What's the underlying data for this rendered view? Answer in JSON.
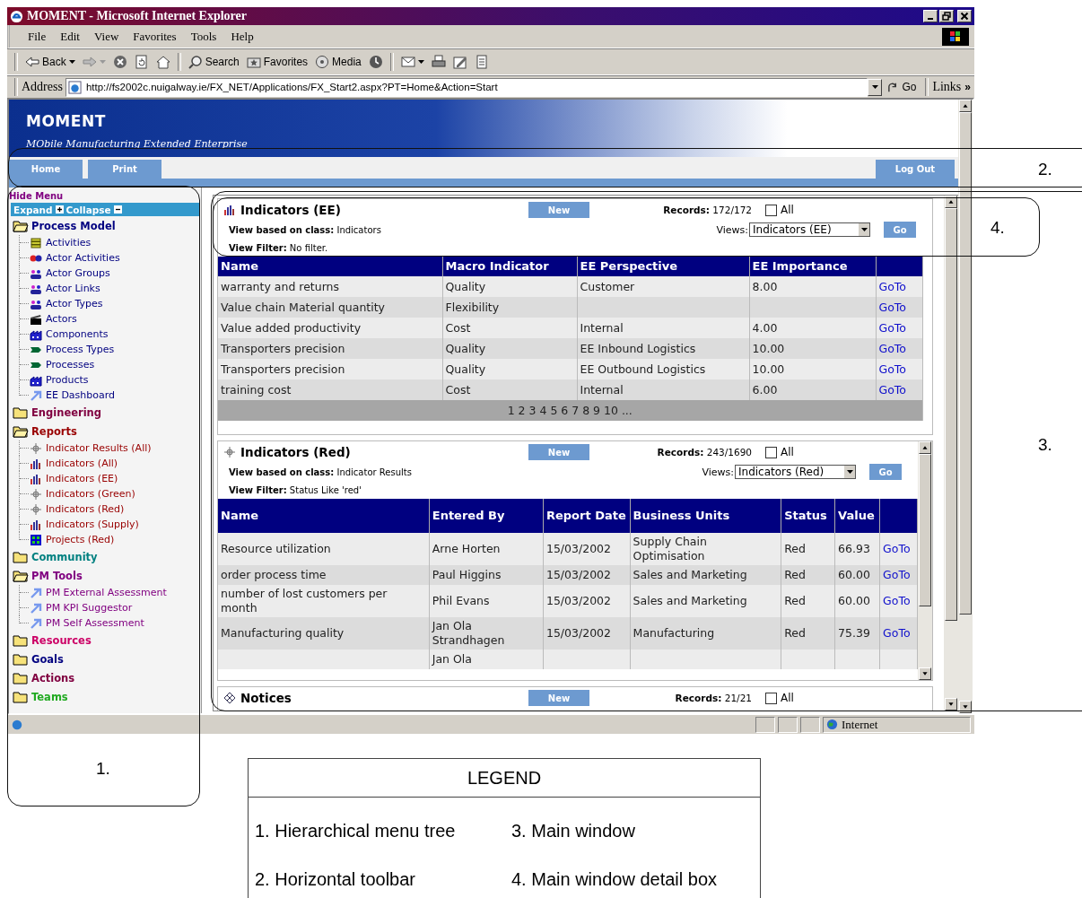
{
  "window": {
    "title": "MOMENT - Microsoft Internet Explorer"
  },
  "menu_bar": [
    "File",
    "Edit",
    "View",
    "Favorites",
    "Tools",
    "Help"
  ],
  "toolbar_groups": [
    [
      {
        "kind": "back",
        "label": "Back"
      },
      {
        "kind": "forward"
      },
      {
        "kind": "stop"
      },
      {
        "kind": "refresh"
      },
      {
        "kind": "home"
      }
    ],
    [
      {
        "kind": "search",
        "label": "Search"
      },
      {
        "kind": "favorites",
        "label": "Favorites"
      },
      {
        "kind": "media",
        "label": "Media"
      },
      {
        "kind": "history"
      }
    ],
    [
      {
        "kind": "mail"
      },
      {
        "kind": "print"
      },
      {
        "kind": "edit"
      },
      {
        "kind": "discuss"
      }
    ]
  ],
  "address_bar": {
    "label": "Address",
    "url": "http://fs2002c.nuigalway.ie/FX_NET/Applications/FX_Start2.aspx?PT=Home&Action=Start",
    "go": "Go",
    "links": "Links",
    "links_more": "»"
  },
  "site": {
    "title": "MOMENT",
    "subtitle": "MObile Manufacturing Extended Enterprise"
  },
  "nav_tabs": [
    {
      "label": "Home"
    },
    {
      "label": "Print"
    }
  ],
  "logout": "Log Out",
  "sidebar": {
    "hide_menu": "Hide Menu",
    "expand": "Expand",
    "collapse": "Collapse",
    "groups": [
      {
        "label": "Process Model",
        "color": "#000080",
        "expanded": true,
        "children": [
          {
            "label": "Activities",
            "kind": "coins"
          },
          {
            "label": "Actor Activities",
            "kind": "actor"
          },
          {
            "label": "Actor Groups",
            "kind": "people"
          },
          {
            "label": "Actor Links",
            "kind": "people"
          },
          {
            "label": "Actor Types",
            "kind": "people"
          },
          {
            "label": "Actors",
            "kind": "clapper"
          },
          {
            "label": "Components",
            "kind": "building"
          },
          {
            "label": "Process Types",
            "kind": "process"
          },
          {
            "label": "Processes",
            "kind": "process"
          },
          {
            "label": "Products",
            "kind": "building"
          },
          {
            "label": "EE Dashboard",
            "kind": "arrow"
          }
        ]
      },
      {
        "label": "Engineering",
        "color": "#800040",
        "expanded": false
      },
      {
        "label": "Reports",
        "color": "#990000",
        "expanded": true,
        "children": [
          {
            "label": "Indicator Results (All)",
            "kind": "target"
          },
          {
            "label": "Indicators (All)",
            "kind": "chart"
          },
          {
            "label": "Indicators (EE)",
            "kind": "chart"
          },
          {
            "label": "Indicators (Green)",
            "kind": "target"
          },
          {
            "label": "Indicators (Red)",
            "kind": "target"
          },
          {
            "label": "Indicators (Supply)",
            "kind": "chart"
          },
          {
            "label": "Projects (Red)",
            "kind": "grid"
          }
        ]
      },
      {
        "label": "Community",
        "color": "#008080",
        "expanded": false
      },
      {
        "label": "PM Tools",
        "color": "#800080",
        "expanded": true,
        "children": [
          {
            "label": "PM External Assessment",
            "kind": "arrow"
          },
          {
            "label": "PM KPI Suggestor",
            "kind": "arrow"
          },
          {
            "label": "PM Self Assessment",
            "kind": "arrow"
          }
        ]
      },
      {
        "label": "Resources",
        "color": "#cc0066",
        "expanded": false
      },
      {
        "label": "Goals",
        "color": "#000080",
        "expanded": false
      },
      {
        "label": "Actions",
        "color": "#800040",
        "expanded": false
      },
      {
        "label": "Teams",
        "color": "#22aa22",
        "expanded": false
      }
    ]
  },
  "panels": [
    {
      "title": "Indicators (EE)",
      "kind": "chart",
      "new_label": "New",
      "records_label": "Records:",
      "records": "172/172",
      "all_label": "All",
      "all_checked": false,
      "class_label": "View based on class:",
      "class_value": "Indicators",
      "views_label": "Views:",
      "views_value": "Indicators (EE)",
      "go": "Go",
      "filter_label": "View Filter:",
      "filter_value": "No filter.",
      "columns": [
        "Name",
        "Macro Indicator",
        "EE Perspective",
        "EE Importance",
        null
      ],
      "rows": [
        [
          "warranty and returns",
          "Quality",
          "Customer",
          "8.00",
          "GoTo"
        ],
        [
          "Value chain Material quantity",
          "Flexibility",
          null,
          null,
          "GoTo"
        ],
        [
          "Value added productivity",
          "Cost",
          "Internal",
          "4.00",
          "GoTo"
        ],
        [
          "Transporters precision",
          "Quality",
          "EE Inbound Logistics",
          "10.00",
          "GoTo"
        ],
        [
          "Transporters precision",
          "Quality",
          "EE Outbound Logistics",
          "10.00",
          "GoTo"
        ],
        [
          "training cost",
          "Cost",
          "Internal",
          "6.00",
          "GoTo"
        ]
      ],
      "pager": "1 2 3 4 5 6 7 8 9 10 ..."
    },
    {
      "title": "Indicators (Red)",
      "kind": "target",
      "new_label": "New",
      "records_label": "Records:",
      "records": "243/1690",
      "all_label": "All",
      "all_checked": false,
      "class_label": "View based on class:",
      "class_value": "Indicator Results",
      "views_label": "Views:",
      "views_value": "Indicators (Red)",
      "go": "Go",
      "filter_label": "View Filter:",
      "filter_value": "Status Like 'red'",
      "columns": [
        "Name",
        "Entered By",
        "Report Date",
        "Business Units",
        "Status",
        "Value",
        null
      ],
      "rows": [
        [
          "Resource utilization",
          "Arne Horten",
          "15/03/2002",
          "Supply Chain Optimisation",
          "Red",
          "66.93",
          "GoTo"
        ],
        [
          "order process time",
          "Paul Higgins",
          "15/03/2002",
          "Sales and Marketing",
          "Red",
          "60.00",
          "GoTo"
        ],
        [
          "number of lost customers per month",
          "Phil Evans",
          "15/03/2002",
          "Sales and Marketing",
          "Red",
          "60.00",
          "GoTo"
        ],
        [
          "Manufacturing quality",
          "Jan Ola Strandhagen",
          "15/03/2002",
          "Manufacturing",
          "Red",
          "75.39",
          "GoTo"
        ],
        [
          null,
          "Jan Ola",
          null,
          null,
          null,
          null,
          null
        ]
      ]
    },
    {
      "title": "Notices",
      "kind": "diamond",
      "new_label": "New",
      "records_label": "Records:",
      "records": "21/21",
      "all_label": "All",
      "all_checked": false
    }
  ],
  "status_bar": {
    "zone": "Internet"
  },
  "annotations": [
    {
      "number": "1."
    },
    {
      "number": "2."
    },
    {
      "number": "3."
    },
    {
      "number": "4."
    }
  ],
  "legend": {
    "title": "LEGEND",
    "items": [
      "1. Hierarchical menu tree",
      "3. Main window",
      "2. Horizontal toolbar",
      "4. Main window detail box"
    ]
  }
}
